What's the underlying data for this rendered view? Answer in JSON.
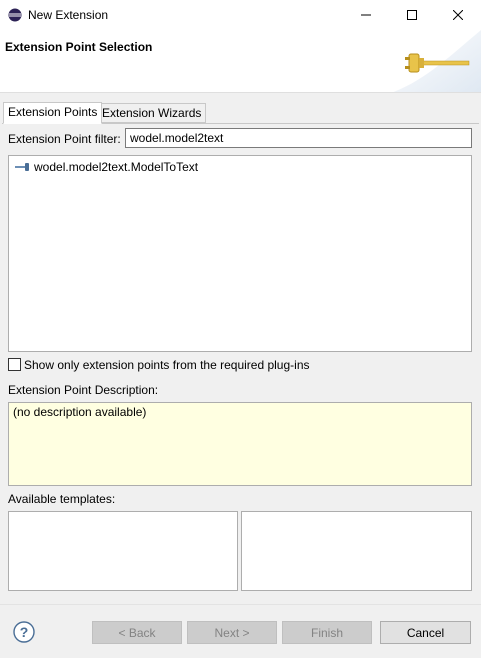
{
  "window": {
    "title": "New Extension",
    "controls": {
      "minimize": "minimize-icon",
      "maximize": "maximize-icon",
      "close": "close-icon"
    }
  },
  "header": {
    "title": "Extension Point Selection",
    "icon": "plug-icon"
  },
  "tabs": [
    {
      "label": "Extension Points",
      "active": true
    },
    {
      "label": "Extension Wizards",
      "active": false
    }
  ],
  "filter": {
    "label": "Extension Point filter:",
    "value": "wodel.model2text"
  },
  "extension_points": [
    {
      "label": "wodel.model2text.ModelToText",
      "icon": "extension-point-icon"
    }
  ],
  "required_only": {
    "label": "Show only extension points from the required plug-ins",
    "checked": false
  },
  "description": {
    "label": "Extension Point Description:",
    "text": "(no description available)"
  },
  "templates": {
    "label": "Available templates:"
  },
  "buttons": {
    "back": "< Back",
    "next": "Next >",
    "finish": "Finish",
    "cancel": "Cancel"
  },
  "colors": {
    "description_background": "#ffffe1",
    "plug_icon": "#e8c34a"
  }
}
